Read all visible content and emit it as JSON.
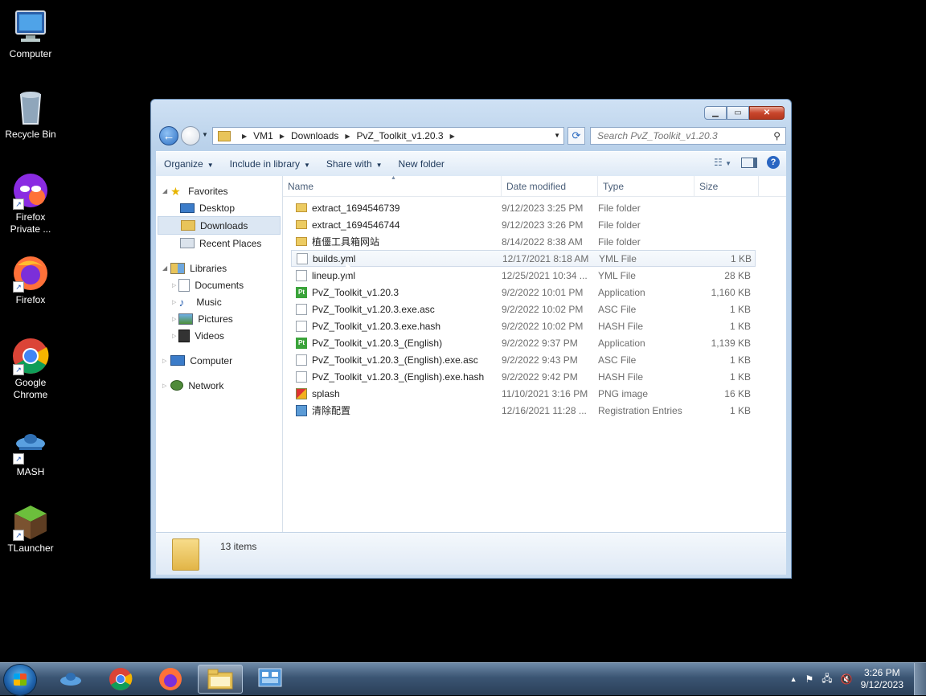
{
  "desktop": {
    "icons": [
      {
        "label": "Computer",
        "icon": "computer-icon"
      },
      {
        "label": "Recycle Bin",
        "icon": "recycle-bin-icon"
      },
      {
        "label": "Firefox Private ...",
        "icon": "firefox-private-icon"
      },
      {
        "label": "Firefox",
        "icon": "firefox-icon"
      },
      {
        "label": "Google Chrome",
        "icon": "chrome-icon"
      },
      {
        "label": "MASH",
        "icon": "mash-icon"
      },
      {
        "label": "TLauncher",
        "icon": "tlauncher-icon"
      }
    ]
  },
  "window": {
    "address": {
      "crumbs": [
        "VM1",
        "Downloads",
        "PvZ_Toolkit_v1.20.3"
      ]
    },
    "search_placeholder": "Search PvZ_Toolkit_v1.20.3",
    "toolbar": {
      "organize": "Organize",
      "include": "Include in library",
      "share": "Share with",
      "new_folder": "New folder"
    },
    "navpane": {
      "favorites": "Favorites",
      "desktop": "Desktop",
      "downloads": "Downloads",
      "recent": "Recent Places",
      "libraries": "Libraries",
      "documents": "Documents",
      "music": "Music",
      "pictures": "Pictures",
      "videos": "Videos",
      "computer": "Computer",
      "network": "Network"
    },
    "columns": {
      "name": "Name",
      "date": "Date modified",
      "type": "Type",
      "size": "Size"
    },
    "files": [
      {
        "name": "extract_1694546739",
        "date": "9/12/2023 3:25 PM",
        "type": "File folder",
        "size": "",
        "icon": "folder"
      },
      {
        "name": "extract_1694546744",
        "date": "9/12/2023 3:26 PM",
        "type": "File folder",
        "size": "",
        "icon": "folder"
      },
      {
        "name": "植僵工具箱网站",
        "date": "8/14/2022 8:38 AM",
        "type": "File folder",
        "size": "",
        "icon": "folder"
      },
      {
        "name": "builds.yml",
        "date": "12/17/2021 8:18 AM",
        "type": "YML File",
        "size": "1 KB",
        "icon": "doc"
      },
      {
        "name": "lineup.yml",
        "date": "12/25/2021 10:34 ...",
        "type": "YML File",
        "size": "28 KB",
        "icon": "doc"
      },
      {
        "name": "PvZ_Toolkit_v1.20.3",
        "date": "9/2/2022 10:01 PM",
        "type": "Application",
        "size": "1,160 KB",
        "icon": "app"
      },
      {
        "name": "PvZ_Toolkit_v1.20.3.exe.asc",
        "date": "9/2/2022 10:02 PM",
        "type": "ASC File",
        "size": "1 KB",
        "icon": "doc"
      },
      {
        "name": "PvZ_Toolkit_v1.20.3.exe.hash",
        "date": "9/2/2022 10:02 PM",
        "type": "HASH File",
        "size": "1 KB",
        "icon": "doc"
      },
      {
        "name": "PvZ_Toolkit_v1.20.3_(English)",
        "date": "9/2/2022 9:37 PM",
        "type": "Application",
        "size": "1,139 KB",
        "icon": "app"
      },
      {
        "name": "PvZ_Toolkit_v1.20.3_(English).exe.asc",
        "date": "9/2/2022 9:43 PM",
        "type": "ASC File",
        "size": "1 KB",
        "icon": "doc"
      },
      {
        "name": "PvZ_Toolkit_v1.20.3_(English).exe.hash",
        "date": "9/2/2022 9:42 PM",
        "type": "HASH File",
        "size": "1 KB",
        "icon": "doc"
      },
      {
        "name": "splash",
        "date": "11/10/2021 3:16 PM",
        "type": "PNG image",
        "size": "16 KB",
        "icon": "png"
      },
      {
        "name": "清除配置",
        "date": "12/16/2021 11:28 ...",
        "type": "Registration Entries",
        "size": "1 KB",
        "icon": "reg"
      }
    ],
    "hover_row": 3,
    "status": "13 items"
  },
  "taskbar": {
    "apps": [
      "mash-icon",
      "chrome-icon",
      "firefox-icon",
      "explorer-icon",
      "control-panel-icon"
    ],
    "time": "3:26 PM",
    "date": "9/12/2023"
  }
}
